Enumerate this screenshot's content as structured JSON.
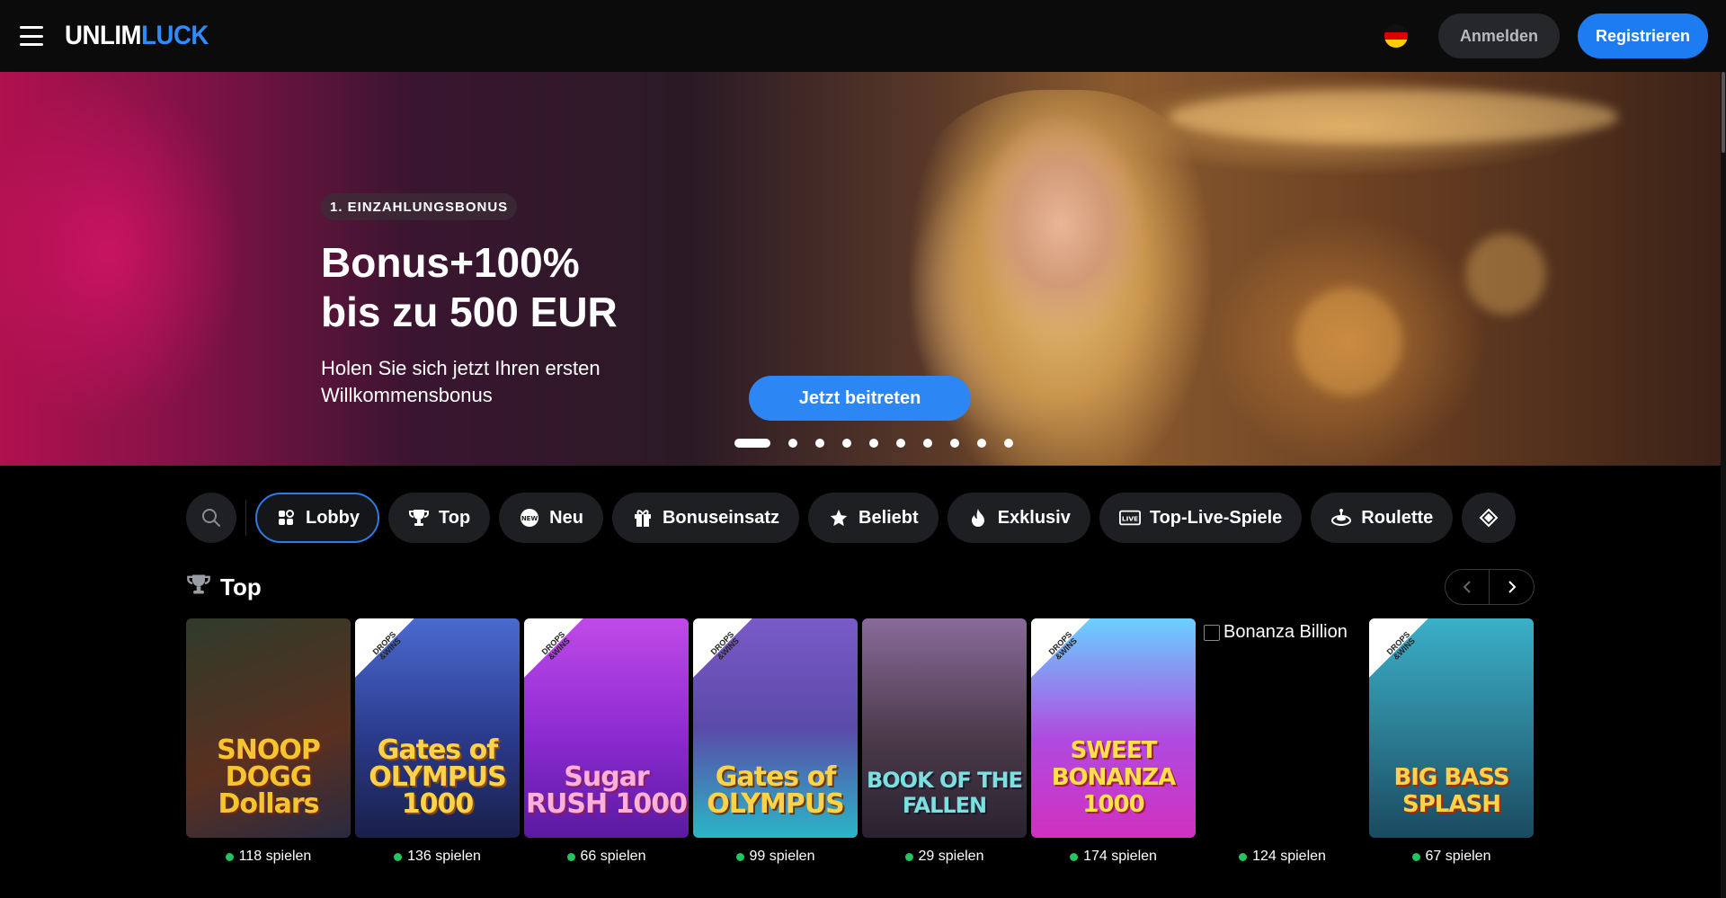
{
  "header": {
    "logo_white": "UNLIM",
    "logo_blue": "LUCK",
    "language_flag": "de-flag-icon",
    "login_label": "Anmelden",
    "register_label": "Registrieren"
  },
  "hero": {
    "badge": "1. EINZAHLUNGSBONUS",
    "title_line1": "Bonus+100%",
    "title_line2": "bis zu 500 EUR",
    "subtitle": "Holen Sie sich jetzt Ihren ersten Willkommensbonus",
    "cta_label": "Jetzt beitreten",
    "slide_count": 10,
    "active_slide": 1
  },
  "categories": [
    {
      "label": "Lobby",
      "icon": "lobby-icon",
      "active": true
    },
    {
      "label": "Top",
      "icon": "trophy-icon",
      "active": false
    },
    {
      "label": "Neu",
      "icon": "new-badge-icon",
      "active": false
    },
    {
      "label": "Bonuseinsatz",
      "icon": "gift-icon",
      "active": false
    },
    {
      "label": "Beliebt",
      "icon": "star-icon",
      "active": false
    },
    {
      "label": "Exklusiv",
      "icon": "flame-icon",
      "active": false
    },
    {
      "label": "Top-Live-Spiele",
      "icon": "live-icon",
      "active": false
    },
    {
      "label": "Roulette",
      "icon": "roulette-icon",
      "active": false
    }
  ],
  "top_section": {
    "title": "Top",
    "games": [
      {
        "name": "Snoop Dogg Dollars",
        "art_text": "SNOOP DOGG Dollars",
        "plays": "118 spielen",
        "drops": false,
        "colors": [
          "#3b2a4a",
          "#7a4a20"
        ]
      },
      {
        "name": "Gates of Olympus 1000",
        "art_text": "Gates of OLYMPUS 1000",
        "plays": "136 spielen",
        "drops": true,
        "colors": [
          "#3a56b8",
          "#1c2a6a"
        ]
      },
      {
        "name": "Sugar Rush 1000",
        "art_text": "Sugar RUSH 1000",
        "plays": "66 spielen",
        "drops": true,
        "colors": [
          "#b63fe6",
          "#6a1fb0"
        ]
      },
      {
        "name": "Gates of Olympus",
        "art_text": "Gates of OLYMPUS",
        "plays": "99 spielen",
        "drops": true,
        "colors": [
          "#6a4fb8",
          "#2ab6c8"
        ]
      },
      {
        "name": "Book of the Fallen",
        "art_text": "BOOK OF THE FALLEN",
        "plays": "29 spielen",
        "drops": false,
        "colors": [
          "#7a5a8a",
          "#2a2a3a"
        ]
      },
      {
        "name": "Sweet Bonanza 1000",
        "art_text": "SWEET BONANZA 1000",
        "plays": "174 spielen",
        "drops": true,
        "colors": [
          "#6ad0ff",
          "#c23fd6"
        ]
      },
      {
        "name": "Bonanza Billion",
        "art_text": "",
        "plays": "124 spielen",
        "drops": false,
        "broken": true,
        "alt": "Bonanza Billion"
      },
      {
        "name": "Big Bass Splash",
        "art_text": "BIG BASS SPLASH",
        "plays": "67 spielen",
        "drops": true,
        "colors": [
          "#2fa0b8",
          "#1e5a70"
        ]
      }
    ]
  },
  "drops_label": "DROPS &WINS",
  "colors": {
    "accent": "#1d7cf2",
    "background": "#000000",
    "pill": "#1e1f23",
    "online_dot": "#22c55e"
  }
}
